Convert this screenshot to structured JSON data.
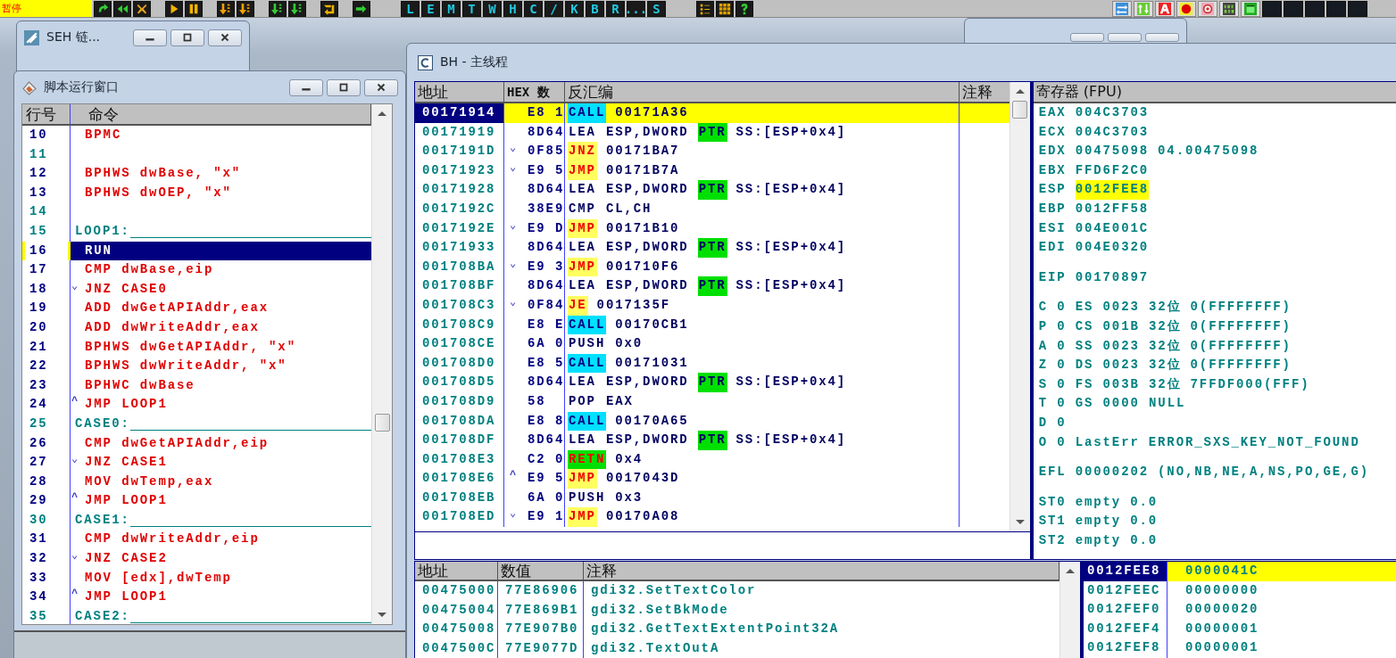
{
  "toolbar": {
    "status": "暂停",
    "letter_buttons": [
      "L",
      "E",
      "M",
      "T",
      "W",
      "H",
      "C",
      "/",
      "K",
      "B",
      "R",
      "...",
      "S"
    ]
  },
  "seh_window": {
    "title": "SEH 链..."
  },
  "script_window": {
    "title": "脚本运行窗口",
    "columns": [
      "行号",
      "命令"
    ],
    "rows": [
      {
        "line": "10",
        "kind": "command",
        "text": "BPMC",
        "selected": false
      },
      {
        "line": "11",
        "kind": "blank",
        "selected": false
      },
      {
        "line": "12",
        "kind": "command",
        "text": "BPHWS dwBase, \"x\"",
        "selected": false
      },
      {
        "line": "13",
        "kind": "command",
        "text": "BPHWS dwOEP, \"x\"",
        "selected": false
      },
      {
        "line": "14",
        "kind": "blank",
        "selected": false
      },
      {
        "line": "15",
        "kind": "label",
        "text": "LOOP1:",
        "selected": false
      },
      {
        "line": "16",
        "kind": "command",
        "text": "RUN",
        "selected": true
      },
      {
        "line": "17",
        "kind": "command",
        "text": "CMP dwBase,eip",
        "selected": false
      },
      {
        "line": "18",
        "kind": "command",
        "jump": "⌄",
        "text": "JNZ CASE0",
        "selected": false
      },
      {
        "line": "19",
        "kind": "command",
        "text": "ADD dwGetAPIAddr,eax",
        "selected": false
      },
      {
        "line": "20",
        "kind": "command",
        "text": "ADD dwWriteAddr,eax",
        "selected": false
      },
      {
        "line": "21",
        "kind": "command",
        "text": "BPHWS dwGetAPIAddr, \"x\"",
        "selected": false
      },
      {
        "line": "22",
        "kind": "command",
        "text": "BPHWS dwWriteAddr, \"x\"",
        "selected": false
      },
      {
        "line": "23",
        "kind": "command",
        "text": "BPHWC dwBase",
        "selected": false
      },
      {
        "line": "24",
        "kind": "command",
        "jump": "^",
        "text": "JMP LOOP1",
        "selected": false
      },
      {
        "line": "25",
        "kind": "label",
        "text": "CASE0:",
        "selected": false
      },
      {
        "line": "26",
        "kind": "command",
        "text": "CMP dwGetAPIAddr,eip",
        "selected": false
      },
      {
        "line": "27",
        "kind": "command",
        "jump": "⌄",
        "text": "JNZ CASE1",
        "selected": false
      },
      {
        "line": "28",
        "kind": "command",
        "text": "MOV dwTemp,eax",
        "selected": false
      },
      {
        "line": "29",
        "kind": "command",
        "jump": "^",
        "text": "JMP LOOP1",
        "selected": false
      },
      {
        "line": "30",
        "kind": "label",
        "text": "CASE1:",
        "selected": false
      },
      {
        "line": "31",
        "kind": "command",
        "text": "CMP dwWriteAddr,eip",
        "selected": false
      },
      {
        "line": "32",
        "kind": "command",
        "jump": "⌄",
        "text": "JNZ CASE2",
        "selected": false
      },
      {
        "line": "33",
        "kind": "command",
        "text": "MOV [edx],dwTemp",
        "selected": false
      },
      {
        "line": "34",
        "kind": "command",
        "jump": "^",
        "text": "JMP LOOP1",
        "selected": false
      },
      {
        "line": "35",
        "kind": "label",
        "text": "CASE2:",
        "selected": false
      }
    ]
  },
  "cpu_window": {
    "title": "BH - 主线程",
    "disassembly": {
      "columns": [
        "地址",
        "HEX 数",
        "反汇编",
        "注释"
      ],
      "rows": [
        {
          "address": "00171914",
          "hex": "E8 1",
          "mnemonic": "CALL",
          "kind": "call",
          "operands": [
            {
              "text": "00171A36",
              "kind": "plain"
            }
          ],
          "selected": true
        },
        {
          "address": "00171919",
          "hex": "8D64",
          "mnemonic": "LEA",
          "kind": "plain",
          "operands": [
            {
              "text": "ESP,DWORD",
              "kind": "plain"
            },
            {
              "text": "PTR",
              "kind": "keyword"
            },
            {
              "text": "SS:[ESP+0x4]",
              "kind": "plain"
            }
          ],
          "selected": false
        },
        {
          "address": "0017191D",
          "jump": "⌄",
          "hex": "0F85",
          "mnemonic": "JNZ",
          "kind": "jump",
          "operands": [
            {
              "text": "00171BA7",
              "kind": "plain"
            }
          ],
          "selected": false
        },
        {
          "address": "00171923",
          "jump": "⌄",
          "hex": "E9 5",
          "mnemonic": "JMP",
          "kind": "jump",
          "operands": [
            {
              "text": "00171B7A",
              "kind": "plain"
            }
          ],
          "selected": false
        },
        {
          "address": "00171928",
          "hex": "8D64",
          "mnemonic": "LEA",
          "kind": "plain",
          "operands": [
            {
              "text": "ESP,DWORD",
              "kind": "plain"
            },
            {
              "text": "PTR",
              "kind": "keyword"
            },
            {
              "text": "SS:[ESP+0x4]",
              "kind": "plain"
            }
          ],
          "selected": false
        },
        {
          "address": "0017192C",
          "hex": "38E9",
          "mnemonic": "CMP",
          "kind": "plain",
          "operands": [
            {
              "text": "CL,CH",
              "kind": "plain"
            }
          ],
          "selected": false
        },
        {
          "address": "0017192E",
          "jump": "⌄",
          "hex": "E9 D",
          "mnemonic": "JMP",
          "kind": "jump",
          "operands": [
            {
              "text": "00171B10",
              "kind": "plain"
            }
          ],
          "selected": false
        },
        {
          "address": "00171933",
          "hex": "8D64",
          "mnemonic": "LEA",
          "kind": "plain",
          "operands": [
            {
              "text": "ESP,DWORD",
              "kind": "plain"
            },
            {
              "text": "PTR",
              "kind": "keyword"
            },
            {
              "text": "SS:[ESP+0x4]",
              "kind": "plain"
            }
          ],
          "selected": false
        },
        {
          "address": "001708BA",
          "jump": "⌄",
          "hex": "E9 3",
          "mnemonic": "JMP",
          "kind": "jump",
          "operands": [
            {
              "text": "001710F6",
              "kind": "plain"
            }
          ],
          "selected": false
        },
        {
          "address": "001708BF",
          "hex": "8D64",
          "mnemonic": "LEA",
          "kind": "plain",
          "operands": [
            {
              "text": "ESP,DWORD",
              "kind": "plain"
            },
            {
              "text": "PTR",
              "kind": "keyword"
            },
            {
              "text": "SS:[ESP+0x4]",
              "kind": "plain"
            }
          ],
          "selected": false
        },
        {
          "address": "001708C3",
          "jump": "⌄",
          "hex": "0F84",
          "mnemonic": "JE",
          "kind": "jump",
          "operands": [
            {
              "text": "0017135F",
              "kind": "plain"
            }
          ],
          "selected": false
        },
        {
          "address": "001708C9",
          "hex": "E8 E",
          "mnemonic": "CALL",
          "kind": "call",
          "operands": [
            {
              "text": "00170CB1",
              "kind": "plain"
            }
          ],
          "selected": false
        },
        {
          "address": "001708CE",
          "hex": "6A 0",
          "mnemonic": "PUSH",
          "kind": "plain",
          "operands": [
            {
              "text": "0x0",
              "kind": "plain"
            }
          ],
          "selected": false
        },
        {
          "address": "001708D0",
          "hex": "E8 5",
          "mnemonic": "CALL",
          "kind": "call",
          "operands": [
            {
              "text": "00171031",
              "kind": "plain"
            }
          ],
          "selected": false
        },
        {
          "address": "001708D5",
          "hex": "8D64",
          "mnemonic": "LEA",
          "kind": "plain",
          "operands": [
            {
              "text": "ESP,DWORD",
              "kind": "plain"
            },
            {
              "text": "PTR",
              "kind": "keyword"
            },
            {
              "text": "SS:[ESP+0x4]",
              "kind": "plain"
            }
          ],
          "selected": false
        },
        {
          "address": "001708D9",
          "hex": "58",
          "mnemonic": "POP",
          "kind": "plain",
          "operands": [
            {
              "text": "EAX",
              "kind": "plain"
            }
          ],
          "selected": false
        },
        {
          "address": "001708DA",
          "hex": "E8 8",
          "mnemonic": "CALL",
          "kind": "call",
          "operands": [
            {
              "text": "00170A65",
              "kind": "plain"
            }
          ],
          "selected": false
        },
        {
          "address": "001708DF",
          "hex": "8D64",
          "mnemonic": "LEA",
          "kind": "plain",
          "operands": [
            {
              "text": "ESP,DWORD",
              "kind": "plain"
            },
            {
              "text": "PTR",
              "kind": "keyword"
            },
            {
              "text": "SS:[ESP+0x4]",
              "kind": "plain"
            }
          ],
          "selected": false
        },
        {
          "address": "001708E3",
          "hex": "C2 0",
          "mnemonic": "RETN",
          "kind": "return",
          "operands": [
            {
              "text": "0x4",
              "kind": "plain"
            }
          ],
          "selected": false
        },
        {
          "address": "001708E6",
          "jump": "^",
          "hex": "E9 5",
          "mnemonic": "JMP",
          "kind": "jump",
          "operands": [
            {
              "text": "0017043D",
              "kind": "plain"
            }
          ],
          "selected": false
        },
        {
          "address": "001708EB",
          "hex": "6A 0",
          "mnemonic": "PUSH",
          "kind": "plain",
          "operands": [
            {
              "text": "0x3",
              "kind": "plain"
            }
          ],
          "selected": false
        },
        {
          "address": "001708ED",
          "jump": "⌄",
          "hex": "E9 1",
          "mnemonic": "JMP",
          "kind": "jump",
          "operands": [
            {
              "text": "00170A08",
              "kind": "plain"
            }
          ],
          "selected": false
        }
      ]
    },
    "registers": {
      "title": "寄存器 (FPU)",
      "sections": [
        [
          {
            "name": "EAX",
            "value": "004C3703"
          },
          {
            "name": "ECX",
            "value": "004C3703"
          },
          {
            "name": "EDX",
            "value": "00475098",
            "note": "04.00475098"
          },
          {
            "name": "EBX",
            "value": "FFD6F2C0"
          },
          {
            "name": "ESP",
            "value": "0012FEE8",
            "highlighted": true
          },
          {
            "name": "EBP",
            "value": "0012FF58"
          },
          {
            "name": "ESI",
            "value": "004E001C"
          },
          {
            "name": "EDI",
            "value": "004E0320"
          }
        ],
        [
          {
            "name": "EIP",
            "value": "00170897"
          }
        ],
        [
          {
            "name": "C 0",
            "value": "ES 0023 32位",
            "note": "0(FFFFFFFF)"
          },
          {
            "name": "P 0",
            "value": "CS 001B 32位",
            "note": "0(FFFFFFFF)"
          },
          {
            "name": "A 0",
            "value": "SS 0023 32位",
            "note": "0(FFFFFFFF)"
          },
          {
            "name": "Z 0",
            "value": "DS 0023 32位",
            "note": "0(FFFFFFFF)"
          },
          {
            "name": "S 0",
            "value": "FS 003B 32位",
            "note": "7FFDF000(FFF)"
          },
          {
            "name": "T 0",
            "value": "GS 0000 NULL"
          },
          {
            "name": "D 0"
          },
          {
            "name": "O 0",
            "value": "LastErr",
            "note": "ERROR_SXS_KEY_NOT_FOUND"
          }
        ],
        [
          {
            "name": "EFL",
            "value": "00000202",
            "note": "(NO,NB,NE,A,NS,PO,GE,G)"
          }
        ],
        [
          {
            "name": "ST0",
            "value": "empty",
            "note": "0.0"
          },
          {
            "name": "ST1",
            "value": "empty",
            "note": "0.0"
          },
          {
            "name": "ST2",
            "value": "empty",
            "note": "0.0"
          }
        ]
      ]
    },
    "dump": {
      "columns": [
        "地址",
        "数值",
        "注释"
      ],
      "rows": [
        {
          "address": "00475000",
          "value": "77E86906",
          "comment": "gdi32.SetTextColor"
        },
        {
          "address": "00475004",
          "value": "77E869B1",
          "comment": "gdi32.SetBkMode"
        },
        {
          "address": "00475008",
          "value": "77E907B0",
          "comment": "gdi32.GetTextExtentPoint32A"
        },
        {
          "address": "0047500C",
          "value": "77E9077D",
          "comment": "gdi32.TextOutA"
        }
      ]
    },
    "stack": {
      "rows": [
        {
          "address": "0012FEE8",
          "value": "0000041C",
          "selected": true
        },
        {
          "address": "0012FEEC",
          "value": "00000000",
          "selected": false
        },
        {
          "address": "0012FEF0",
          "value": "00000020",
          "selected": false
        },
        {
          "address": "0012FEF4",
          "value": "00000001",
          "selected": false
        },
        {
          "address": "0012FEF8",
          "value": "00000001",
          "selected": false
        }
      ]
    }
  }
}
